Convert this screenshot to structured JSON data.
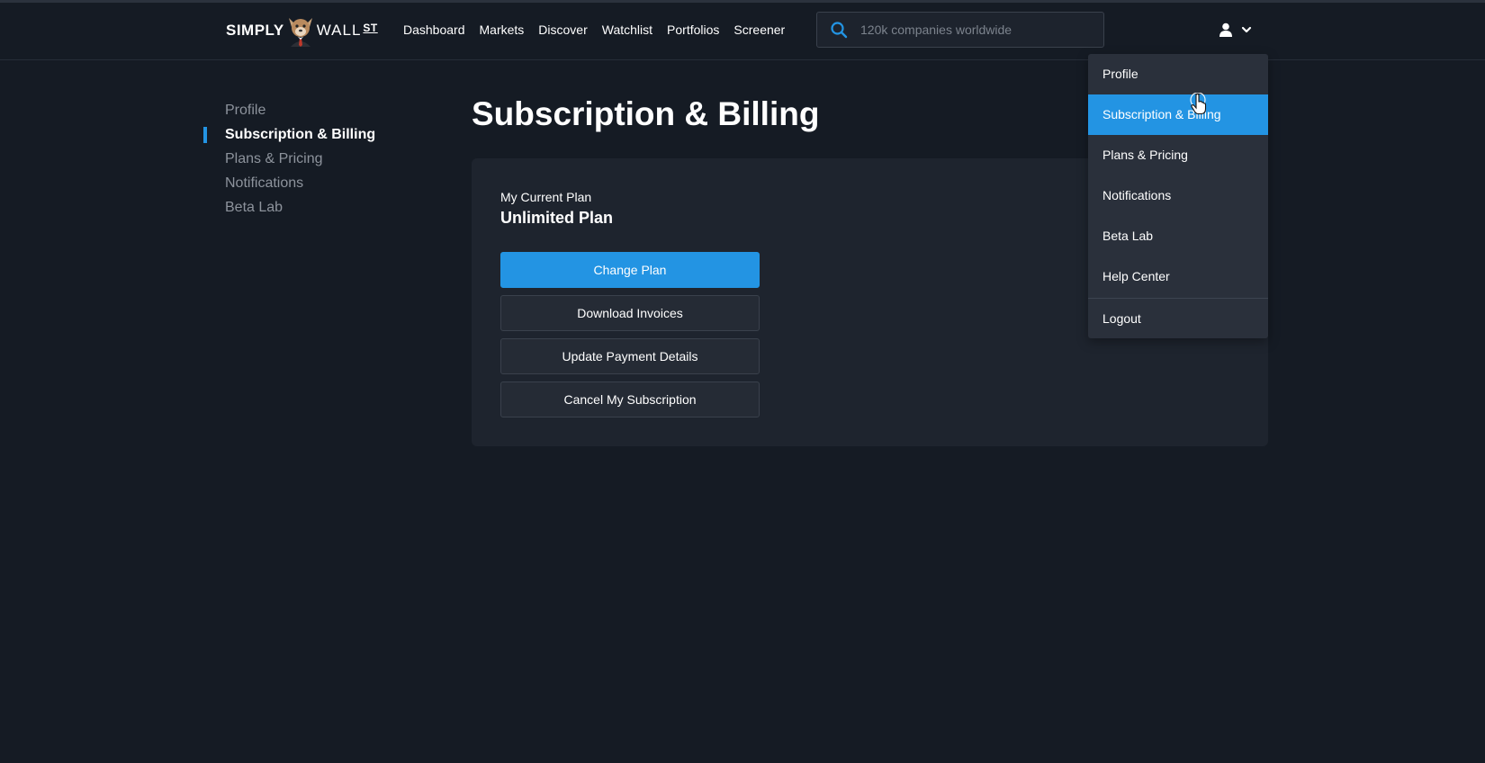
{
  "header": {
    "logo": {
      "part1": "SIMPLY",
      "part2": "WALL",
      "part3": "ST"
    },
    "nav": [
      "Dashboard",
      "Markets",
      "Discover",
      "Watchlist",
      "Portfolios",
      "Screener"
    ],
    "search": {
      "placeholder": "120k companies worldwide",
      "value": ""
    }
  },
  "sidebar": {
    "items": [
      {
        "label": "Profile",
        "active": false
      },
      {
        "label": "Subscription & Billing",
        "active": true
      },
      {
        "label": "Plans & Pricing",
        "active": false
      },
      {
        "label": "Notifications",
        "active": false
      },
      {
        "label": "Beta Lab",
        "active": false
      }
    ]
  },
  "main": {
    "title": "Subscription & Billing",
    "card": {
      "label": "My Current Plan",
      "plan": "Unlimited Plan",
      "buttons": [
        "Change Plan",
        "Download Invoices",
        "Update Payment Details",
        "Cancel My Subscription"
      ]
    }
  },
  "dropdown": {
    "items": [
      "Profile",
      "Subscription & Billing",
      "Plans & Pricing",
      "Notifications",
      "Beta Lab",
      "Help Center"
    ],
    "active_index": 1,
    "logout": "Logout"
  },
  "colors": {
    "background": "#151b24",
    "card": "#1e242e",
    "accent": "#2394e3",
    "dropdown": "#2a303b",
    "muted_text": "#8d939c"
  },
  "icons": [
    "search-icon",
    "user-icon",
    "chevron-down-icon",
    "mascot-logo",
    "hand-cursor-icon"
  ]
}
